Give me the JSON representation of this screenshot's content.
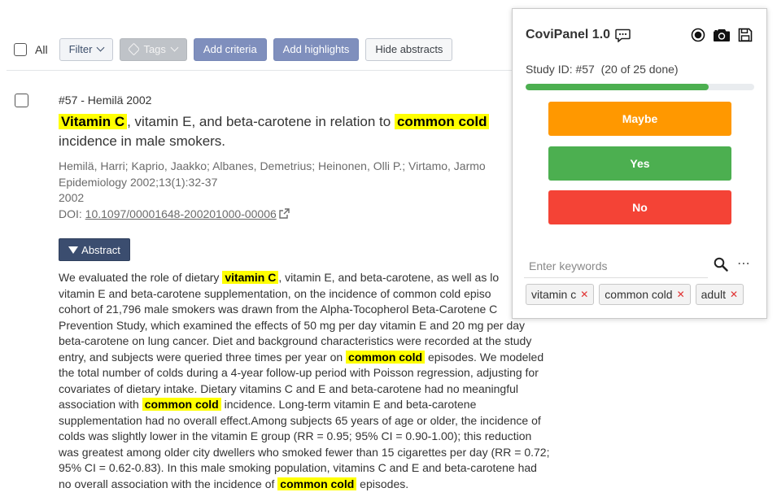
{
  "toolbar": {
    "all_label": "All",
    "filter_label": "Filter",
    "tags_label": "Tags",
    "add_criteria_label": "Add criteria",
    "add_highlights_label": "Add highlights",
    "hide_abstracts_label": "Hide abstracts"
  },
  "study": {
    "id_line": "#57 - Hemilä 2002",
    "title": [
      {
        "text": "Vitamin C",
        "hl": true
      },
      {
        "text": ", vitamin E, and beta-carotene in relation to ",
        "hl": false
      },
      {
        "text": "common cold",
        "hl": true
      },
      {
        "text": " incidence in male smokers.",
        "hl": false
      }
    ],
    "authors": "Hemilä, Harri; Kaprio, Jaakko; Albanes, Demetrius; Heinonen, Olli P.; Virtamo, Jarmo",
    "journal": "Epidemiology 2002;13(1):32-37",
    "year": "2002",
    "doi_label": "DOI:",
    "doi": "10.1097/00001648-200201000-00006",
    "abstract_button": "Abstract",
    "abstract_lines": [
      [
        {
          "text": "We evaluated the role of dietary ",
          "hl": false
        },
        {
          "text": "vitamin C",
          "hl": true
        },
        {
          "text": ", vitamin E, and beta-carotene, as well as lo",
          "hl": false
        }
      ],
      [
        {
          "text": "vitamin E and beta-carotene supplementation, on the incidence of common cold episo",
          "hl": false
        }
      ],
      [
        {
          "text": "cohort of 21,796 male smokers was drawn from the Alpha-Tocopherol Beta-Carotene C",
          "hl": false
        }
      ],
      [
        {
          "text": "Prevention Study, which examined the effects of 50 mg per day vitamin E and 20 mg per day",
          "hl": false
        }
      ],
      [
        {
          "text": "beta-carotene on lung cancer. Diet and background characteristics were recorded at the study",
          "hl": false
        }
      ],
      [
        {
          "text": "entry, and subjects were queried three times per year on ",
          "hl": false
        },
        {
          "text": "common cold",
          "hl": true
        },
        {
          "text": " episodes. We modeled",
          "hl": false
        }
      ],
      [
        {
          "text": "the total number of colds during a 4-year follow-up period with Poisson regression, adjusting for",
          "hl": false
        }
      ],
      [
        {
          "text": "covariates of dietary intake. Dietary vitamins C and E and beta-carotene had no meaningful",
          "hl": false
        }
      ],
      [
        {
          "text": "association with ",
          "hl": false
        },
        {
          "text": "common cold",
          "hl": true
        },
        {
          "text": " incidence. Long-term vitamin E and beta-carotene",
          "hl": false
        }
      ],
      [
        {
          "text": "supplementation had no overall effect.Among subjects 65 years of age or older, the incidence of",
          "hl": false
        }
      ],
      [
        {
          "text": "colds was slightly lower in the vitamin E group (RR = 0.95; 95% CI = 0.90-1.00); this reduction",
          "hl": false
        }
      ],
      [
        {
          "text": "was greatest among older city dwellers who smoked fewer than 15 cigarettes per day (RR = 0.72;",
          "hl": false
        }
      ],
      [
        {
          "text": "95% CI = 0.62-0.83). In this male smoking population, vitamins C and E and beta-carotene had",
          "hl": false
        }
      ],
      [
        {
          "text": "no overall association with the incidence of ",
          "hl": false
        },
        {
          "text": "common cold",
          "hl": true
        },
        {
          "text": " episodes.",
          "hl": false
        }
      ]
    ]
  },
  "panel": {
    "title": "CoviPanel 1.0",
    "study_id": "Study ID: #57",
    "progress_text": "(20 of 25 done)",
    "progress_fraction": 0.8,
    "maybe_label": "Maybe",
    "yes_label": "Yes",
    "no_label": "No",
    "keywords_placeholder": "Enter keywords",
    "keywords": [
      "vitamin c",
      "common cold",
      "adult"
    ],
    "colors": {
      "maybe": "#ff9800",
      "yes": "#4caf50",
      "no": "#f44336",
      "highlight": "#ffff00"
    }
  }
}
